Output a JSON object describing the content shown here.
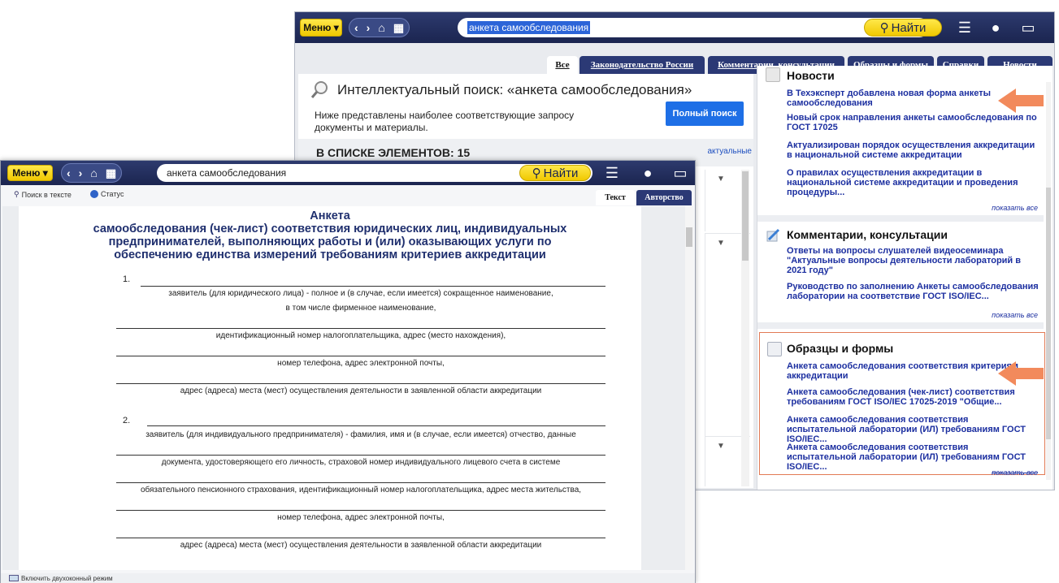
{
  "back_window": {
    "toolbar": {
      "menu_label": "Меню ▾",
      "nav_back": "‹",
      "nav_forward": "›",
      "nav_home": "⌂",
      "nav_grid": "▦",
      "search_value": "анкета самообследования",
      "find_label": "Найти"
    },
    "tabs": [
      {
        "label": "Все",
        "active": true
      },
      {
        "label": "Законодательство России",
        "active": false
      },
      {
        "label": "Комментарии, консультации",
        "active": false
      },
      {
        "label": "Образцы и формы",
        "active": false
      },
      {
        "label": "Справки",
        "active": false
      },
      {
        "label": "Новости",
        "active": false
      }
    ],
    "search_panel": {
      "title": "Интеллектуальный поиск: «анкета самообследования»",
      "description": "Ниже представлены наиболее соответствующие запросу документы и материалы.",
      "full_search_button": "Полный поиск",
      "list_header": "В СПИСКЕ ЭЛЕМЕНТОВ: 15",
      "actual_label": "актуальные"
    },
    "right_panel": {
      "news": {
        "title": "Новости",
        "items": [
          "В Техэксперт добавлена новая форма анкеты самообследования",
          "Новый срок направления анкеты самообследования по ГОСТ 17025",
          "Актуализирован порядок осуществления аккредитации в национальной системе аккредитации",
          "О правилах осуществления аккредитации в национальной системе аккредитации и проведения процедуры..."
        ],
        "show_all": "показать все"
      },
      "comments": {
        "title": "Комментарии, консультации",
        "items": [
          "Ответы на вопросы слушателей видеосеминара \"Актуальные вопросы деятельности лабораторий в 2021 году\"",
          "Руководство по заполнению Анкеты самообследования лаборатории на соответствие ГОСТ ISO/IEC..."
        ],
        "show_all": "показать все"
      },
      "forms": {
        "title": "Образцы и формы",
        "items": [
          "Анкета самообследования соответствия критериям аккредитации",
          "Анкета самообследования (чек-лист) соответствия требованиям ГОСТ ISO/IEC 17025-2019 \"Общие...",
          "Анкета самообследования соответствия испытательной лаборатории (ИЛ) требованиям ГОСТ ISO/IEC...",
          "Анкета самообследования соответствия испытательной лаборатории (ИЛ) требованиям ГОСТ ISO/IEC..."
        ],
        "show_all": "показать все"
      }
    }
  },
  "front_window": {
    "toolbar": {
      "menu_label": "Меню ▾",
      "search_value": "анкета самообследования",
      "find_label": "Найти"
    },
    "subbar": {
      "search_in_text": "Поиск в тексте",
      "status": "Статус"
    },
    "tabs": [
      {
        "label": "Текст",
        "active": true
      },
      {
        "label": "Авторство",
        "active": false
      }
    ],
    "document": {
      "title_line1": "Анкета",
      "title_line2": "самообследования (чек-лист) соответствия юридических лиц, индивидуальных",
      "title_line3": "предпринимателей, выполняющих работы и (или) оказывающих услуги по",
      "title_line4": "обеспечению единства измерений требованиям критериев аккредитации",
      "num1": "1.",
      "cap1a": "заявитель (для юридического лица) - полное и (в случае, если имеется) сокращенное наименование,",
      "cap1b": "в том числе фирменное наименование,",
      "cap2": "идентификационный номер налогоплательщика, адрес (место нахождения),",
      "cap3": "номер телефона, адрес электронной почты,",
      "cap4": "адрес (адреса) места (мест) осуществления деятельности в заявленной области аккредитации",
      "num2": "2.",
      "cap5": "заявитель (для индивидуального предпринимателя) - фамилия, имя и (в случае, если имеется) отчество, данные",
      "cap6": "документа, удостоверяющего его личность, страховой номер индивидуального лицевого счета в системе",
      "cap7": "обязательного пенсионного страхования, идентификационный номер налогоплательщика, адрес места жительства,",
      "cap8": "номер телефона, адрес электронной почты,",
      "cap9": "адрес (адреса) места (мест) осуществления деятельности в заявленной области аккредитации"
    },
    "status_bar": "Включить двухоконный режим"
  },
  "colors": {
    "toolbar": "#1b2550",
    "accent_yellow": "#f0c800",
    "tab_blue": "#2b3975",
    "link_blue": "#1c2fa0",
    "full_search_blue": "#1e6fe6",
    "annotation_orange": "#f28a5c"
  }
}
